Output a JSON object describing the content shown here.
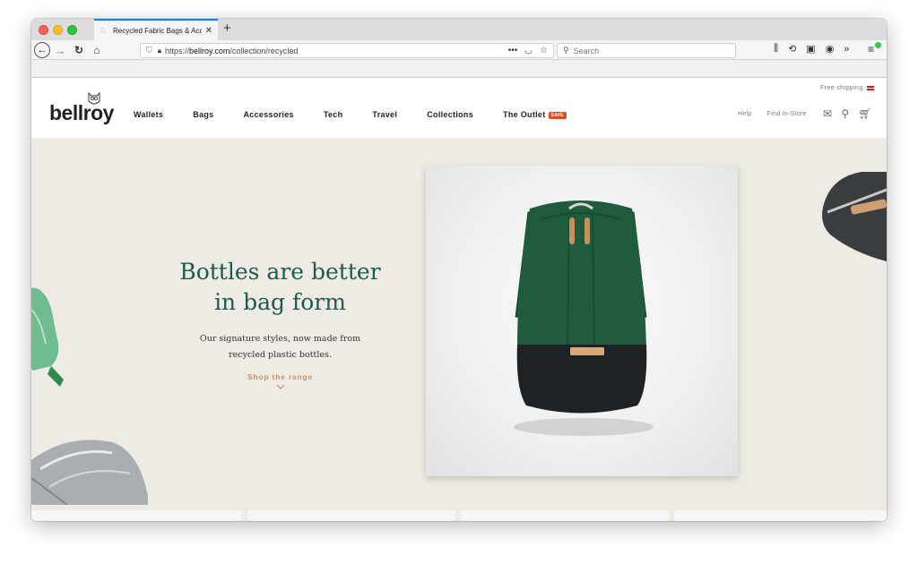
{
  "browser": {
    "tab_title": "Recycled Fabric Bags & Access",
    "tab_close": "✕",
    "new_tab": "+",
    "url_prefix": "https://",
    "url_domain": "bellroy.com",
    "url_path": "/collection/recycled",
    "search_placeholder": "Search",
    "icons": [
      "shield-icon",
      "lock-icon",
      "more-icon",
      "pocket-icon",
      "bookmark-star-icon",
      "library-icon",
      "history-icon",
      "reader-icon",
      "account-icon",
      "overflow-icon",
      "hamburger-menu-icon"
    ]
  },
  "header": {
    "free_shipping": "Free shipping",
    "logo": "bellroy",
    "nav": [
      "Wallets",
      "Bags",
      "Accessories",
      "Tech",
      "Travel",
      "Collections",
      "The Outlet"
    ],
    "outlet_badge": "SAVE",
    "help": "Help",
    "find_in_store": "Find In-Store"
  },
  "hero": {
    "title_line1": "Bottles are better",
    "title_line2": "in bag form",
    "subtitle_line1": "Our signature styles, now made from",
    "subtitle_line2": "recycled plastic bottles.",
    "cta": "Shop the range"
  },
  "colors": {
    "hero_bg": "#eeebe5",
    "title_green": "#1e5b4b",
    "cta_tan": "#cc8f63",
    "save_badge": "#e04b1c",
    "backpack_green": "#1f5b3c",
    "backpack_base": "#1e2224"
  }
}
